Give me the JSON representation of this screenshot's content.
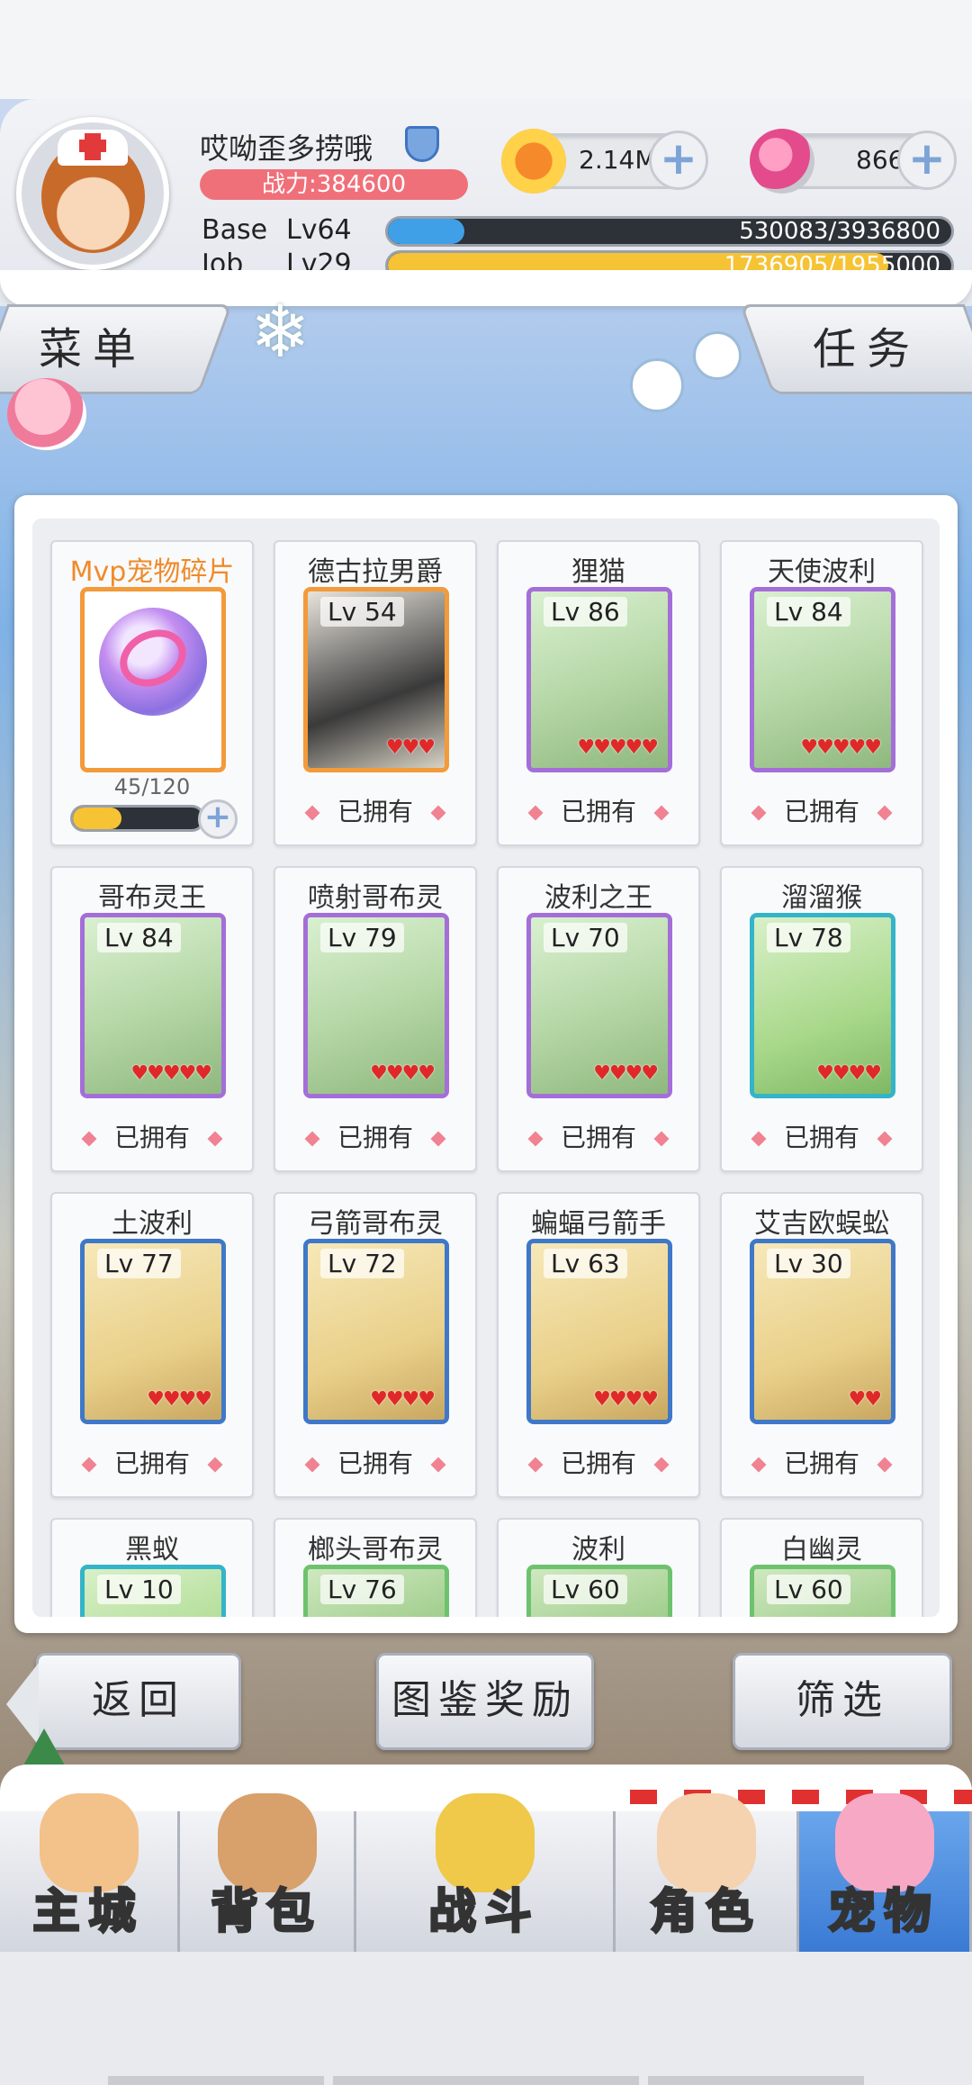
{
  "player": {
    "name": "哎呦歪多捞哦",
    "power": "战力:384600",
    "zeny": "2.14M",
    "gems": "866",
    "base_label": "Base",
    "base_level": "Lv64",
    "base_exp": "530083/3936800",
    "base_exp_fraction": 0.135,
    "job_label": "Job",
    "job_level": "Lv29",
    "job_exp": "1736905/1955000",
    "job_exp_fraction": 0.888
  },
  "header_buttons": {
    "menu": "菜单",
    "tasks": "任务"
  },
  "mvp_card": {
    "name": "Mvp宠物碎片",
    "count": "45/120",
    "fraction": 0.375
  },
  "owned_label": "已拥有",
  "pets": [
    {
      "name": "德古拉男爵",
      "level": "Lv 54",
      "hearts": 3,
      "frame": "orange"
    },
    {
      "name": "狸猫",
      "level": "Lv 86",
      "hearts": 5,
      "frame": "purple"
    },
    {
      "name": "天使波利",
      "level": "Lv 84",
      "hearts": 5,
      "frame": "purple"
    },
    {
      "name": "哥布灵王",
      "level": "Lv 84",
      "hearts": 5,
      "frame": "purple"
    },
    {
      "name": "喷射哥布灵",
      "level": "Lv 79",
      "hearts": 4,
      "frame": "purple"
    },
    {
      "name": "波利之王",
      "level": "Lv 70",
      "hearts": 4,
      "frame": "purple"
    },
    {
      "name": "溜溜猴",
      "level": "Lv 78",
      "hearts": 4,
      "frame": "cyan"
    },
    {
      "name": "土波利",
      "level": "Lv 77",
      "hearts": 4,
      "frame": "blue"
    },
    {
      "name": "弓箭哥布灵",
      "level": "Lv 72",
      "hearts": 4,
      "frame": "blue"
    },
    {
      "name": "蝙蝠弓箭手",
      "level": "Lv 63",
      "hearts": 4,
      "frame": "blue"
    },
    {
      "name": "艾吉欧蜈蚣",
      "level": "Lv 30",
      "hearts": 2,
      "frame": "blue"
    },
    {
      "name": "黑蚁",
      "level": "Lv 10",
      "hearts": 0,
      "frame": "cyan"
    },
    {
      "name": "榔头哥布灵",
      "level": "Lv 76",
      "hearts": 0,
      "frame": "green"
    },
    {
      "name": "波利",
      "level": "Lv 60",
      "hearts": 0,
      "frame": "green"
    },
    {
      "name": "白幽灵",
      "level": "Lv 60",
      "hearts": 0,
      "frame": "green"
    }
  ],
  "actions": {
    "back": "返回",
    "codex_reward": "图鉴奖励",
    "filter": "筛选"
  },
  "nav": [
    {
      "label": "主城",
      "icon": "castle-icon"
    },
    {
      "label": "背包",
      "icon": "backpack-icon"
    },
    {
      "label": "战斗",
      "icon": "battle-icon"
    },
    {
      "label": "角色",
      "icon": "character-icon"
    },
    {
      "label": "宠物",
      "icon": "pet-icon",
      "active": true
    }
  ],
  "colors": {
    "accent_pink": "#f08292",
    "power_badge": "#f0707a",
    "base_exp_bar": "#3fa0e8",
    "job_exp_bar": "#f6c335",
    "nav_active": "#3a7ad4"
  }
}
